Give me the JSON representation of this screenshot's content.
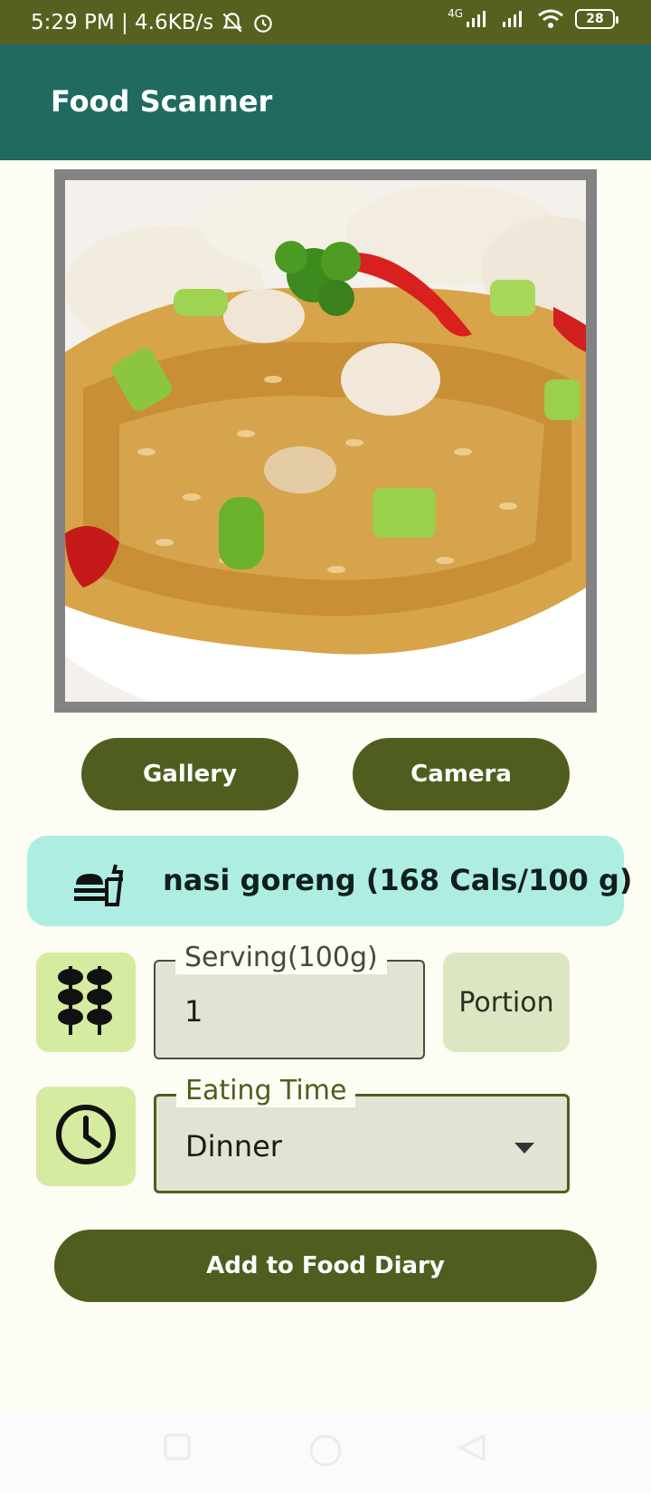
{
  "status_bar": {
    "time_speed": "5:29 PM | 4.6KB/s",
    "network_type": "4G",
    "battery_level": "28"
  },
  "app_bar": {
    "title": "Food Scanner"
  },
  "photo": {
    "subject": "nasi goreng plate",
    "icon": "food-photo"
  },
  "actions": {
    "gallery_label": "Gallery",
    "camera_label": "Camera"
  },
  "result": {
    "text": "nasi goreng (168 Cals/100 g)",
    "icon": "food-tray-icon"
  },
  "serving": {
    "label": "Serving(100g)",
    "value": "1",
    "icon": "skewer-icon"
  },
  "portion": {
    "label": "Portion"
  },
  "eating_time": {
    "label": "Eating Time",
    "value": "Dinner",
    "icon": "clock-icon"
  },
  "add_button": {
    "label": "Add to Food Diary"
  },
  "colors": {
    "status_bar": "#56611f",
    "app_bar": "#206a60",
    "button": "#4f5e1e",
    "result_card": "#aeeee2",
    "icon_tile": "#d5eba0",
    "background": "#fdfdf3"
  }
}
